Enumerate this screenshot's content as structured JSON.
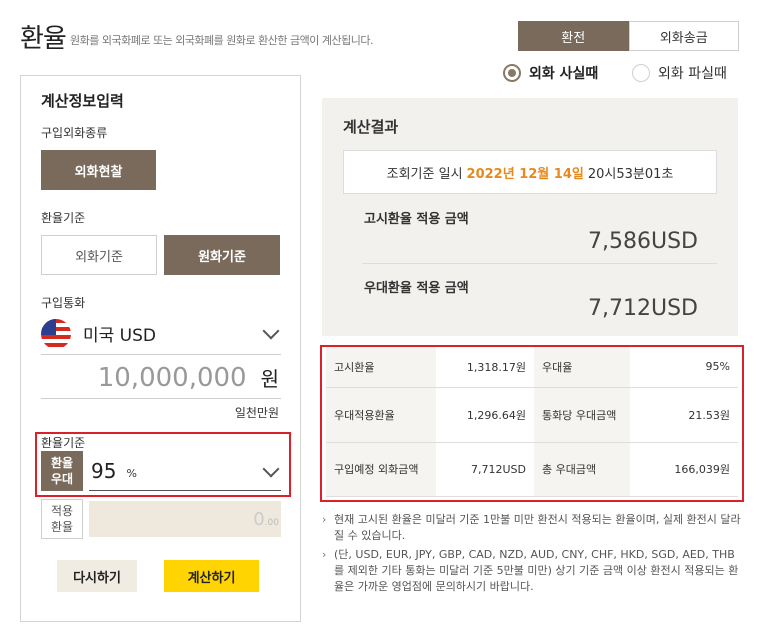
{
  "header": {
    "title": "환율",
    "description": "원화를 외국화폐로 또는 외국화폐를 원화로 환산한 금액이 계산됩니다."
  },
  "tabs": [
    {
      "label": "환전",
      "active": true
    },
    {
      "label": "외화송금",
      "active": false
    }
  ],
  "mode": {
    "buy_label": "외화 사실때",
    "sell_label": "외화 파실때",
    "selected": "buy"
  },
  "calc_input": {
    "title": "계산정보입력",
    "purchase_type_label": "구입외화종류",
    "purchase_type_button": "외화현찰",
    "rate_basis_label": "환율기준",
    "rate_basis_options": [
      "외화기준",
      "원화기준"
    ],
    "rate_basis_selected": "원화기준",
    "currency_label": "구입통화",
    "currency_value": "미국 USD",
    "amount_value": "10,000,000",
    "amount_unit": "원",
    "amount_words": "일천만원",
    "preferential_label": "환율기준",
    "preferential_badge": [
      "환율",
      "우대"
    ],
    "preferential_value": "95",
    "preferential_unit": "%",
    "applied_badge": [
      "적용",
      "환율"
    ],
    "applied_value": "0",
    "applied_decimal": ".00",
    "reset_button": "다시하기",
    "calc_button": "계산하기"
  },
  "result": {
    "title": "계산결과",
    "date_prefix": "조회기준 일시",
    "date_highlight": "2022년 12월 14일",
    "date_suffix": "20시53분01초",
    "notice_rate_label": "고시환율 적용 금액",
    "notice_rate_value": "7,586USD",
    "preferred_rate_label": "우대환율 적용 금액",
    "preferred_rate_value": "7,712USD"
  },
  "details": {
    "rows": [
      {
        "l1": "고시환율",
        "v1": "1,318.17원",
        "l2": "우대율",
        "v2": "95%"
      },
      {
        "l1": "우대적용환율",
        "v1": "1,296.64원",
        "l2": "통화당 우대금액",
        "v2": "21.53원"
      },
      {
        "l1": "구입예정 외화금액",
        "v1": "7,712USD",
        "l2": "총 우대금액",
        "v2": "166,039원"
      }
    ]
  },
  "notes": [
    "현재 고시된 환율은 미달러 기준 1만불 미만 환전시 적용되는 환율이며, 실제 환전시 달라질 수 있습니다.",
    "(단, USD, EUR, JPY, GBP, CAD, NZD, AUD, CNY, CHF, HKD, SGD, AED, THB를 제외한 기타 통화는 미달러 기준 5만불 미만) 상기 기준 금액 이상 환전시 적용되는 환율은 가까운 영업점에 문의하시기 바랍니다."
  ],
  "colors": {
    "brown": "#7a6a5b",
    "highlight_orange": "#e8891c",
    "calc_yellow": "#ffd400",
    "alert_red": "#d9202b"
  }
}
